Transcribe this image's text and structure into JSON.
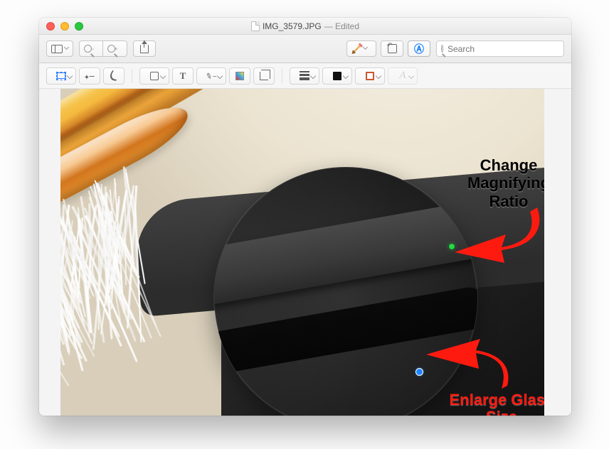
{
  "window": {
    "title": "IMG_3579.JPG",
    "title_suffix": "— Edited"
  },
  "main_toolbar": {
    "sidebar_toggle": "Sidebar",
    "zoom_out": "−",
    "zoom_in": "+",
    "share": "Share",
    "highlight": "Highlight",
    "rotate": "Rotate",
    "markup": "Markup",
    "search_placeholder": "Search"
  },
  "edit_toolbar": {
    "select_rect": "Rectangular Selection",
    "instant_alpha": "Instant Alpha",
    "sketch": "Sketch",
    "shapes": "Shapes",
    "text": "T",
    "sign": "Sign",
    "note": "Adjust Color",
    "mask": "Adjust Size",
    "line_style": "Shape Style",
    "fill": "Fill Color",
    "stroke": "Border Color",
    "font_label": "A"
  },
  "annotations": {
    "line1": "Change",
    "line2": "Magnifying",
    "line3": "Ratio",
    "b_line1": "Enlarge Glass",
    "b_line2": "Size"
  },
  "colors": {
    "arrow": "#ff1a10",
    "handle_green": "#29d648",
    "handle_blue": "#1f86ff"
  }
}
